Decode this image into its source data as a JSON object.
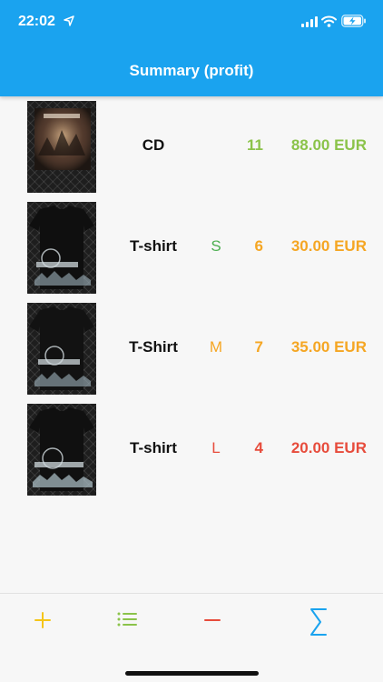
{
  "status_bar": {
    "time": "22:02"
  },
  "header": {
    "title": "Summary (profit)"
  },
  "items": [
    {
      "name": "CD",
      "size": "",
      "quantity": "11",
      "amount": "88.00 EUR",
      "image": "CD album cover"
    },
    {
      "name": "T-shirt",
      "size": "S",
      "quantity": "6",
      "amount": "30.00 EUR",
      "image": "black band T-shirt"
    },
    {
      "name": "T-Shirt",
      "size": "M",
      "quantity": "7",
      "amount": "35.00 EUR",
      "image": "black band T-shirt"
    },
    {
      "name": "T-shirt",
      "size": "L",
      "quantity": "4",
      "amount": "20.00 EUR",
      "image": "black band T-shirt"
    }
  ],
  "tabs": [
    {
      "icon": "plus-icon",
      "color": "#f5c518"
    },
    {
      "icon": "list-icon",
      "color": "#8bc34a"
    },
    {
      "icon": "minus-icon",
      "color": "#e74c3c"
    },
    {
      "icon": "sigma-icon",
      "color": "#1aa3ef",
      "active": true
    }
  ],
  "colors": {
    "header": "#1aa3ef",
    "green": "#8bc34a",
    "orange": "#f5a623",
    "red": "#e74c3c"
  }
}
